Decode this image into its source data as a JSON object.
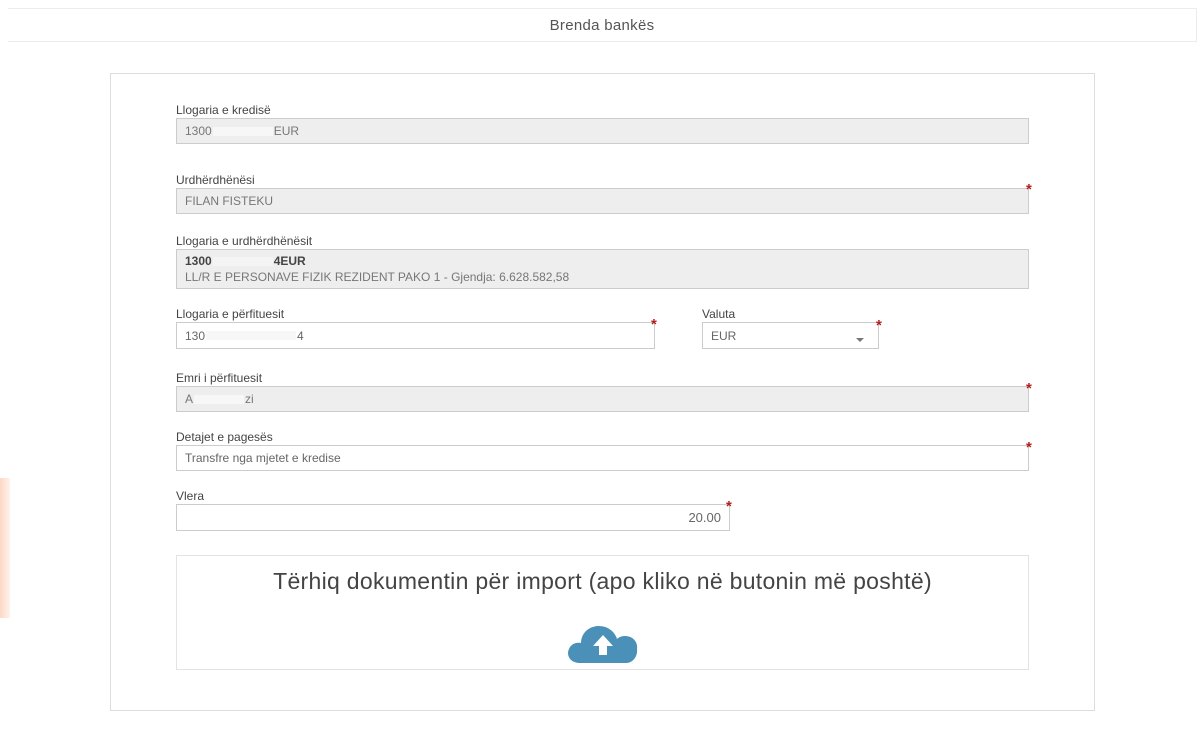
{
  "header": {
    "title": "Brenda bankës"
  },
  "form": {
    "credit_account": {
      "label": "Llogaria e kredisë",
      "value_start": "1300",
      "value_end": "EUR"
    },
    "payer": {
      "label": "Urdhërdhënësi",
      "value": "FILAN FISTEKU",
      "required_mark": "*"
    },
    "payer_account": {
      "label": "Llogaria e urdhërdhënësit",
      "line1_start": "1300",
      "line1_end": "4EUR",
      "line2": "LL/R E PERSONAVE FIZIK REZIDENT PAKO 1 - Gjendja: 6.628.582,58"
    },
    "beneficiary_account": {
      "label": "Llogaria e përfituesit",
      "value_start": "130",
      "value_end": "4",
      "required_mark": "*"
    },
    "currency": {
      "label": "Valuta",
      "selected": "EUR",
      "required_mark": "*"
    },
    "beneficiary_name": {
      "label": "Emri i përfituesit",
      "value_start": "A",
      "value_end": "zi",
      "required_mark": "*"
    },
    "payment_details": {
      "label": "Detajet e pagesës",
      "value": "Transfre nga mjetet e kredise",
      "required_mark": "*"
    },
    "amount": {
      "label": "Vlera",
      "value": "20.00",
      "required_mark": "*"
    }
  },
  "dropzone": {
    "text": "Tërhiq dokumentin për import (apo kliko në butonin më poshtë)",
    "icon": "cloud-upload-icon",
    "icon_color": "#4a90b8"
  },
  "colors": {
    "required": "#b21d1d",
    "readonly_bg": "#eeeeee",
    "border": "#cccccc"
  }
}
